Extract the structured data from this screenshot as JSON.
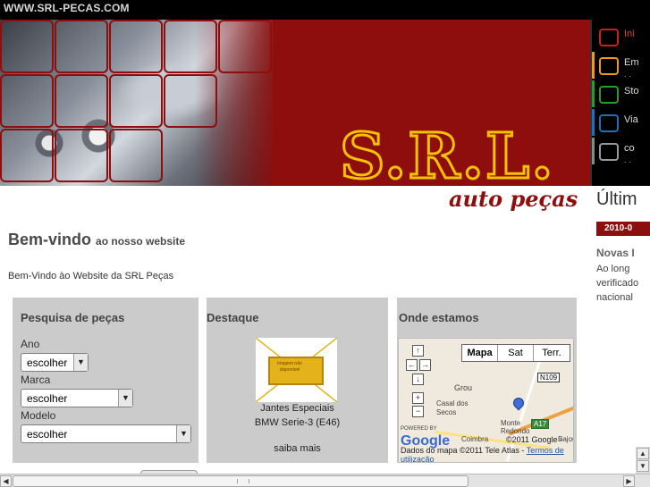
{
  "site_url": "WWW.SRL-PECAS.COM",
  "banner": {
    "logo_text": "S.R.L.",
    "subtitle": "auto peças"
  },
  "nav": {
    "items": [
      {
        "label": "Ini",
        "color": "#cc1f1f"
      },
      {
        "label": "Em",
        "color": "#f09a1c"
      },
      {
        "label": "Sto",
        "color": "#2b9b2b"
      },
      {
        "label": "Via",
        "color": "#1f6fbf"
      },
      {
        "label": "co",
        "color": "#888888"
      }
    ]
  },
  "main": {
    "welcome_title": "Bem-vindo",
    "welcome_sub": "ao nosso website",
    "intro": "Bem-Vindo ào Website da SRL Peças"
  },
  "search_panel": {
    "title": "Pesquisa de peças",
    "fields": [
      {
        "label": "Ano",
        "value": "escolher"
      },
      {
        "label": "Marca",
        "value": "escolher"
      },
      {
        "label": "Modelo",
        "value": "escolher"
      }
    ]
  },
  "featured_panel": {
    "title": "Destaque",
    "image_text": "imagem não disponível",
    "product_line1": "Jantes Especiais",
    "product_line2": "BMW Serie-3 (E46)",
    "more_link": "saiba mais"
  },
  "map_panel": {
    "title": "Onde estamos",
    "map_types": [
      "Mapa",
      "Sat",
      "Terr."
    ],
    "labels": {
      "grou": "Grou",
      "casal": "Casal dos",
      "secos": "Secos",
      "monte": "Monte",
      "redondo": "Redondo",
      "coimbra": "Coimbra",
      "bajou": "Bajou",
      "road_n109": "N109",
      "road_a17": "A17",
      "powered_by": "POWERED BY",
      "google": "Google"
    },
    "copyright_1": "©2011 Google -",
    "copyright_2": "Dados do mapa ©2011 Tele Atlas -",
    "terms": "Termos de utilização"
  },
  "right_column": {
    "title": "Últim",
    "date": "2010-0",
    "news_title": "Novas I",
    "news_text": "Ao long verificado nacional"
  }
}
